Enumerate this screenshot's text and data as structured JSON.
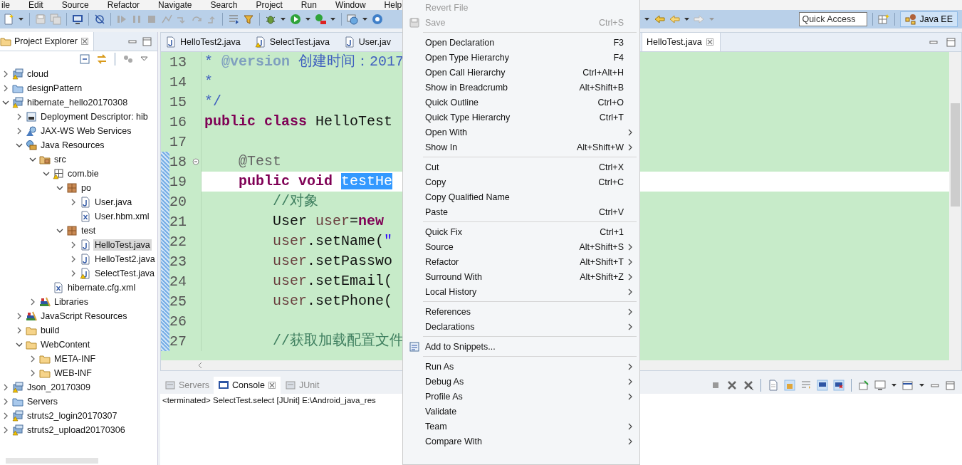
{
  "menubar": [
    "ile",
    "Edit",
    "Source",
    "Refactor",
    "Navigate",
    "Search",
    "Project",
    "Run",
    "Window",
    "Help"
  ],
  "toolbar": {
    "quick_access": {
      "placeholder": "Quick Access"
    },
    "perspective": {
      "label": "Java EE",
      "selected": true
    }
  },
  "project_explorer": {
    "title": "Project Explorer",
    "tree": [
      {
        "label": "cloud",
        "kind": "project",
        "expanded": false,
        "selected": false
      },
      {
        "label": "designPattern",
        "kind": "project-folder",
        "expanded": false,
        "selected": false
      },
      {
        "label": "hibernate_hello20170308",
        "kind": "project",
        "expanded": true,
        "selected": false,
        "children": [
          {
            "label": "Deployment Descriptor: hib",
            "kind": "descriptor",
            "expanded": false,
            "selected": false
          },
          {
            "label": "JAX-WS Web Services",
            "kind": "webservice",
            "expanded": false,
            "selected": false
          },
          {
            "label": "Java Resources",
            "kind": "java-resources",
            "expanded": true,
            "selected": false,
            "children": [
              {
                "label": "src",
                "kind": "source-folder",
                "expanded": true,
                "selected": false,
                "children": [
                  {
                    "label": "com.bie",
                    "kind": "package-empty",
                    "expanded": true,
                    "selected": false,
                    "children": [
                      {
                        "label": "po",
                        "kind": "package",
                        "expanded": true,
                        "selected": false,
                        "children": [
                          {
                            "label": "User.java",
                            "kind": "java",
                            "expanded": false,
                            "selected": false
                          },
                          {
                            "label": "User.hbm.xml",
                            "kind": "xml",
                            "selected": false
                          }
                        ]
                      },
                      {
                        "label": "test",
                        "kind": "package",
                        "expanded": true,
                        "selected": false,
                        "children": [
                          {
                            "label": "HelloTest.java",
                            "kind": "java",
                            "expanded": false,
                            "selected": true
                          },
                          {
                            "label": "HelloTest2.java",
                            "kind": "java",
                            "expanded": false,
                            "selected": false
                          },
                          {
                            "label": "SelectTest.java",
                            "kind": "java-warning",
                            "expanded": false,
                            "selected": false
                          }
                        ]
                      }
                    ]
                  },
                  {
                    "label": "hibernate.cfg.xml",
                    "kind": "xml",
                    "selected": false
                  }
                ]
              },
              {
                "label": "Libraries",
                "kind": "library",
                "expanded": false,
                "selected": false
              }
            ]
          },
          {
            "label": "JavaScript Resources",
            "kind": "library",
            "expanded": false,
            "selected": false
          },
          {
            "label": "build",
            "kind": "folder",
            "expanded": false,
            "selected": false
          },
          {
            "label": "WebContent",
            "kind": "folder",
            "expanded": true,
            "selected": false,
            "children": [
              {
                "label": "META-INF",
                "kind": "folder",
                "expanded": false,
                "selected": false
              },
              {
                "label": "WEB-INF",
                "kind": "folder",
                "expanded": false,
                "selected": false
              }
            ]
          }
        ]
      },
      {
        "label": "Json_20170309",
        "kind": "project",
        "expanded": false,
        "selected": false
      },
      {
        "label": "Servers",
        "kind": "project-folder",
        "expanded": false,
        "selected": false
      },
      {
        "label": "struts2_login20170307",
        "kind": "project",
        "expanded": false,
        "selected": false
      },
      {
        "label": "struts2_upload20170306",
        "kind": "project",
        "expanded": false,
        "selected": false
      }
    ]
  },
  "editor": {
    "tabs": [
      {
        "label": "HelloTest2.java",
        "kind": "java",
        "selected": false
      },
      {
        "label": "SelectTest.java",
        "kind": "java-warning",
        "selected": false
      },
      {
        "label": "User.jav",
        "kind": "java",
        "selected": false
      },
      {
        "label": "HelloTest.java",
        "kind": "plain",
        "selected": true
      }
    ],
    "lines": [
      {
        "number": "13",
        "current": false,
        "in_range": false,
        "foldable": false,
        "segments": [
          {
            "kind": "javadoc",
            "text": "* "
          },
          {
            "kind": "javadoc-tag",
            "text": "@version"
          },
          {
            "kind": "javadoc",
            "text": " 创建时间：2017"
          }
        ]
      },
      {
        "number": "14",
        "current": false,
        "in_range": false,
        "foldable": false,
        "segments": [
          {
            "kind": "javadoc",
            "text": "*"
          }
        ]
      },
      {
        "number": "15",
        "current": false,
        "in_range": false,
        "foldable": false,
        "segments": [
          {
            "kind": "javadoc",
            "text": "*/"
          }
        ]
      },
      {
        "number": "16",
        "current": false,
        "in_range": false,
        "foldable": false,
        "segments": [
          {
            "kind": "keyword",
            "text": "public "
          },
          {
            "kind": "keyword",
            "text": "class"
          },
          {
            "kind": "plain",
            "text": " HelloTest"
          }
        ]
      },
      {
        "number": "17",
        "current": false,
        "in_range": false,
        "foldable": false
      },
      {
        "number": "18",
        "current": false,
        "in_range": true,
        "foldable": true,
        "segments": [
          {
            "kind": "annotation",
            "text": "    @Test"
          }
        ]
      },
      {
        "number": "19",
        "current": true,
        "in_range": true,
        "foldable": false,
        "segments": [
          {
            "kind": "keyword",
            "text": "    public "
          },
          {
            "kind": "keyword",
            "text": "void "
          },
          {
            "kind": "selected",
            "text": "testHe"
          }
        ]
      },
      {
        "number": "20",
        "current": false,
        "in_range": true,
        "foldable": false,
        "segments": [
          {
            "kind": "comment",
            "text": "        //对象"
          }
        ]
      },
      {
        "number": "21",
        "current": false,
        "in_range": true,
        "foldable": false,
        "segments": [
          {
            "kind": "plain",
            "text": "        User "
          },
          {
            "kind": "variable",
            "text": "user"
          },
          {
            "kind": "plain",
            "text": "="
          },
          {
            "kind": "keyword",
            "text": "new"
          }
        ]
      },
      {
        "number": "22",
        "current": false,
        "in_range": true,
        "foldable": false,
        "segments": [
          {
            "kind": "variable",
            "text": "        user"
          },
          {
            "kind": "plain",
            "text": ".setName("
          },
          {
            "kind": "string",
            "text": "\""
          }
        ]
      },
      {
        "number": "23",
        "current": false,
        "in_range": true,
        "foldable": false,
        "segments": [
          {
            "kind": "variable",
            "text": "        user"
          },
          {
            "kind": "plain",
            "text": ".setPasswo"
          }
        ]
      },
      {
        "number": "24",
        "current": false,
        "in_range": true,
        "foldable": false,
        "segments": [
          {
            "kind": "variable",
            "text": "        user"
          },
          {
            "kind": "plain",
            "text": ".setEmail("
          }
        ]
      },
      {
        "number": "25",
        "current": false,
        "in_range": true,
        "foldable": false,
        "segments": [
          {
            "kind": "variable",
            "text": "        user"
          },
          {
            "kind": "plain",
            "text": ".setPhone("
          }
        ]
      },
      {
        "number": "26",
        "current": false,
        "in_range": true,
        "foldable": false
      },
      {
        "number": "27",
        "current": false,
        "in_range": true,
        "foldable": false,
        "segments": [
          {
            "kind": "comment",
            "text": "        //获取加载配置文件"
          }
        ]
      }
    ]
  },
  "console": {
    "tabs": [
      {
        "label": "Servers",
        "kind": "servers",
        "selected": false
      },
      {
        "label": "Console",
        "kind": "console",
        "selected": true
      },
      {
        "label": "JUnit",
        "kind": "junit",
        "selected": false
      }
    ],
    "output": "<terminated> SelectTest.select [JUnit] E:\\Android_java_res"
  },
  "context_menu": {
    "items": [
      {
        "kind": "item",
        "label": "Revert File",
        "submenu": false,
        "disabled": true
      },
      {
        "kind": "save-item",
        "label": "Save",
        "shortcut": "Ctrl+S",
        "submenu": false,
        "disabled": true
      },
      {
        "kind": "separator"
      },
      {
        "kind": "item",
        "label": "Open Declaration",
        "shortcut": "F3",
        "submenu": false,
        "disabled": false
      },
      {
        "kind": "item",
        "label": "Open Type Hierarchy",
        "shortcut": "F4",
        "submenu": false,
        "disabled": false
      },
      {
        "kind": "item",
        "label": "Open Call Hierarchy",
        "shortcut": "Ctrl+Alt+H",
        "submenu": false,
        "disabled": false
      },
      {
        "kind": "item",
        "label": "Show in Breadcrumb",
        "shortcut": "Alt+Shift+B",
        "submenu": false,
        "disabled": false
      },
      {
        "kind": "item",
        "label": "Quick Outline",
        "shortcut": "Ctrl+O",
        "submenu": false,
        "disabled": false
      },
      {
        "kind": "item",
        "label": "Quick Type Hierarchy",
        "shortcut": "Ctrl+T",
        "submenu": false,
        "disabled": false
      },
      {
        "kind": "item",
        "label": "Open With",
        "submenu": true,
        "disabled": false
      },
      {
        "kind": "item",
        "label": "Show In",
        "shortcut": "Alt+Shift+W",
        "submenu": true,
        "disabled": false
      },
      {
        "kind": "separator"
      },
      {
        "kind": "item",
        "label": "Cut",
        "shortcut": "Ctrl+X",
        "submenu": false,
        "disabled": false
      },
      {
        "kind": "item",
        "label": "Copy",
        "shortcut": "Ctrl+C",
        "submenu": false,
        "disabled": false
      },
      {
        "kind": "item",
        "label": "Copy Qualified Name",
        "submenu": false,
        "disabled": false
      },
      {
        "kind": "item",
        "label": "Paste",
        "shortcut": "Ctrl+V",
        "submenu": false,
        "disabled": false
      },
      {
        "kind": "separator"
      },
      {
        "kind": "item",
        "label": "Quick Fix",
        "shortcut": "Ctrl+1",
        "submenu": false,
        "disabled": false
      },
      {
        "kind": "item",
        "label": "Source",
        "shortcut": "Alt+Shift+S",
        "submenu": true,
        "disabled": false
      },
      {
        "kind": "item",
        "label": "Refactor",
        "shortcut": "Alt+Shift+T",
        "submenu": true,
        "disabled": false
      },
      {
        "kind": "item",
        "label": "Surround With",
        "shortcut": "Alt+Shift+Z",
        "submenu": true,
        "disabled": false
      },
      {
        "kind": "item",
        "label": "Local History",
        "submenu": true,
        "disabled": false
      },
      {
        "kind": "separator"
      },
      {
        "kind": "item",
        "label": "References",
        "submenu": true,
        "disabled": false
      },
      {
        "kind": "item",
        "label": "Declarations",
        "submenu": true,
        "disabled": false
      },
      {
        "kind": "separator"
      },
      {
        "kind": "snippet-item",
        "label": "Add to Snippets...",
        "submenu": false,
        "disabled": false
      },
      {
        "kind": "separator"
      },
      {
        "kind": "item",
        "label": "Run As",
        "submenu": true,
        "disabled": false
      },
      {
        "kind": "item",
        "label": "Debug As",
        "submenu": true,
        "disabled": false
      },
      {
        "kind": "item",
        "label": "Profile As",
        "submenu": true,
        "disabled": false
      },
      {
        "kind": "item",
        "label": "Validate",
        "submenu": false,
        "disabled": false
      },
      {
        "kind": "item",
        "label": "Team",
        "submenu": true,
        "disabled": false
      },
      {
        "kind": "item",
        "label": "Compare With",
        "submenu": true,
        "disabled": false
      }
    ]
  }
}
